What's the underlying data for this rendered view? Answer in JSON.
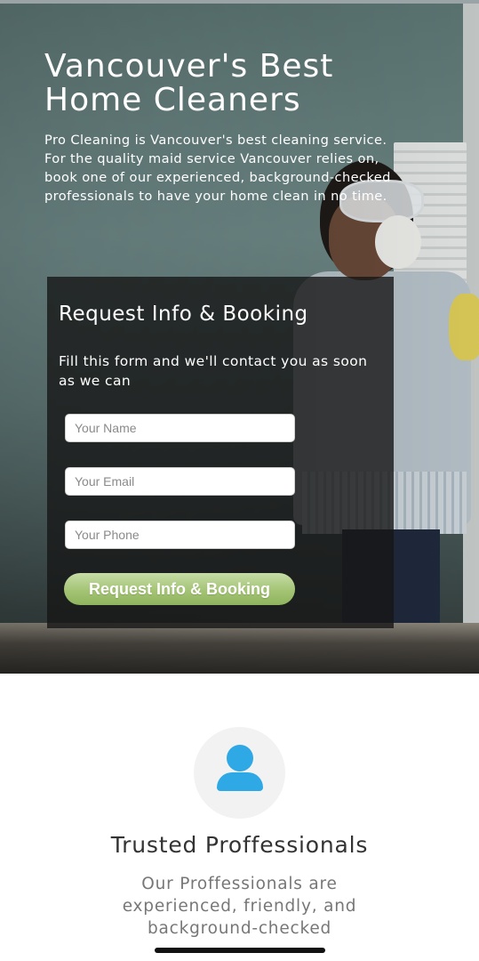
{
  "hero": {
    "title": "Vancouver's Best Home Cleaners",
    "description": "Pro Cleaning is Vancouver's best cleaning service. For the quality maid service Vancouver relies on, book one of our experienced, background-checked professionals to have your home clean in no time."
  },
  "form": {
    "title": "Request Info & Booking",
    "subtitle": "Fill this form and we'll contact you as soon as we can",
    "name_placeholder": "Your Name",
    "email_placeholder": "Your Email",
    "phone_placeholder": "Your Phone",
    "submit_label": "Request Info & Booking"
  },
  "feature": {
    "icon": "user-icon",
    "title": "Trusted Proffessionals",
    "description": "Our Proffessionals are experienced, friendly, and background-checked"
  },
  "colors": {
    "accent_green": "#a4c474",
    "icon_blue": "#2fa8e6",
    "form_panel": "rgba(22,22,22,0.80)"
  }
}
